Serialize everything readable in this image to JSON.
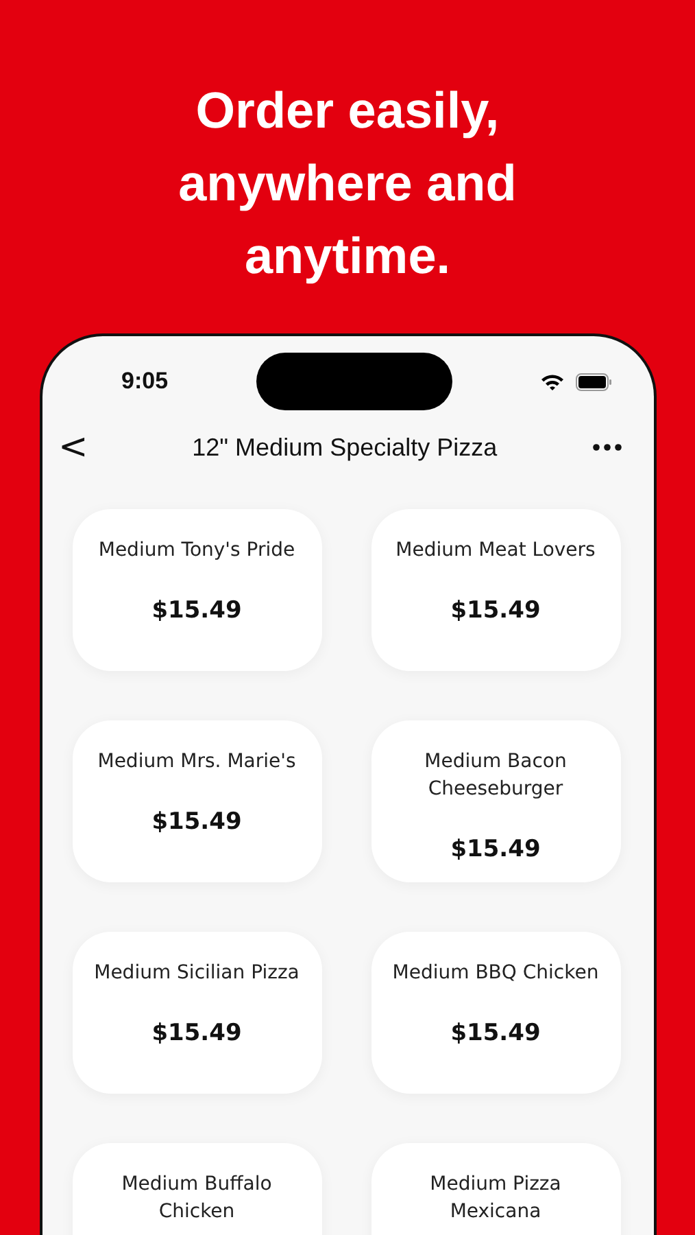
{
  "headline": "Order easily, anywhere and anytime.",
  "status_bar": {
    "time": "9:05"
  },
  "nav": {
    "back": "<",
    "title": "12\" Medium Specialty Pizza"
  },
  "items": [
    {
      "name": "Medium Tony's Pride",
      "price": "$15.49"
    },
    {
      "name": "Medium Meat Lovers",
      "price": "$15.49"
    },
    {
      "name": "Medium Mrs. Marie's",
      "price": "$15.49"
    },
    {
      "name": "Medium Bacon Cheeseburger",
      "price": "$15.49"
    },
    {
      "name": "Medium Sicilian Pizza",
      "price": "$15.49"
    },
    {
      "name": "Medium BBQ Chicken",
      "price": "$15.49"
    },
    {
      "name": "Medium Buffalo Chicken"
    },
    {
      "name": "Medium Pizza Mexicana"
    }
  ]
}
